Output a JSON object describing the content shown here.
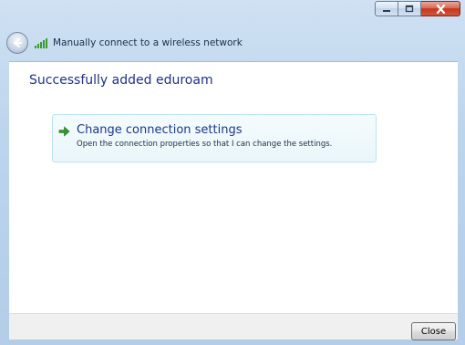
{
  "window": {
    "title": "Manually connect to a wireless network",
    "buttons": {
      "minimize": "minimize-icon",
      "maximize": "maximize-icon",
      "close": "close-icon"
    }
  },
  "main": {
    "heading": "Successfully added eduroam",
    "command_link": {
      "title": "Change connection settings",
      "description": "Open the connection properties so that I can change the settings."
    }
  },
  "footer": {
    "close_label": "Close"
  },
  "colors": {
    "heading": "#1e3287",
    "arrow": "#2f9a2c",
    "signal": "#3a9a2e"
  }
}
